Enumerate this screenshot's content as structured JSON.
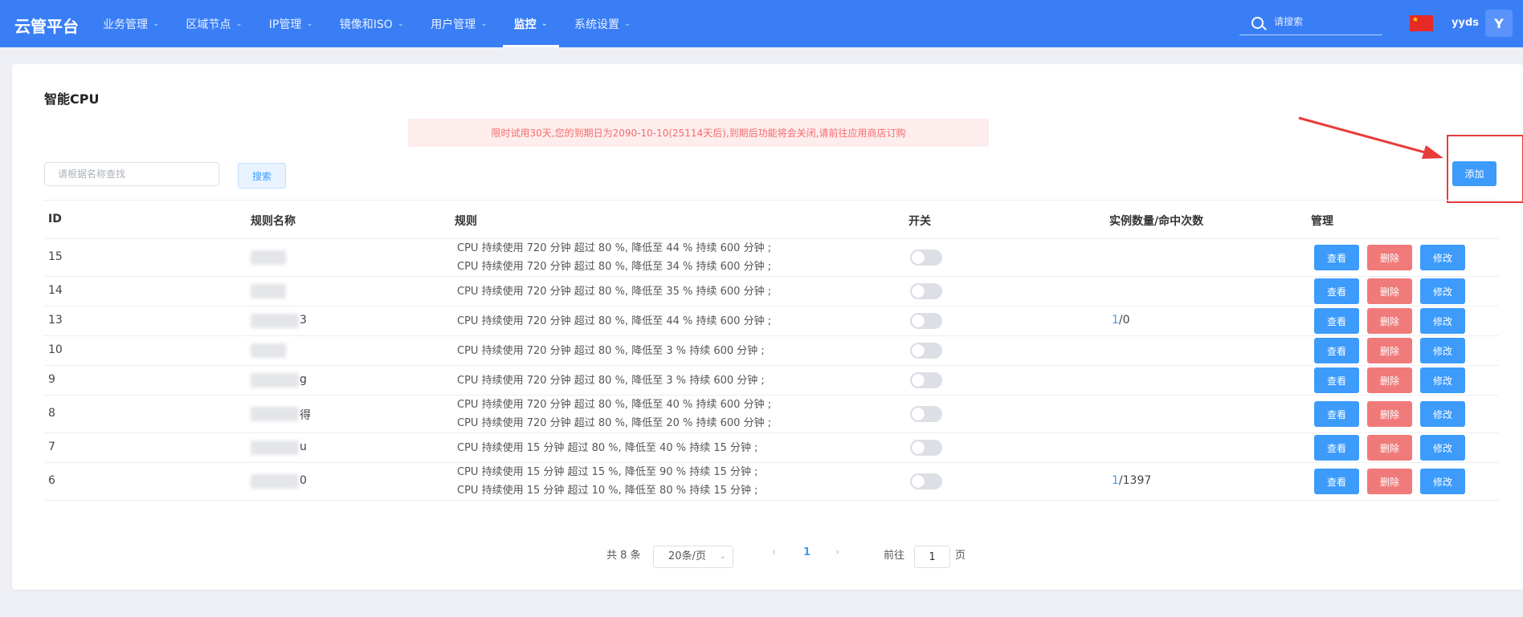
{
  "brand": "云管平台",
  "nav": [
    {
      "label": "业务管理",
      "name": "nav-business"
    },
    {
      "label": "区域节点",
      "name": "nav-region"
    },
    {
      "label": "IP管理",
      "name": "nav-ip"
    },
    {
      "label": "镜像和ISO",
      "name": "nav-image"
    },
    {
      "label": "用户管理",
      "name": "nav-user"
    },
    {
      "label": "监控",
      "name": "nav-monitor",
      "active": true
    },
    {
      "label": "系统设置",
      "name": "nav-settings"
    }
  ],
  "header": {
    "search_placeholder": "请搜索",
    "username": "yyds",
    "avatar_letter": "Y",
    "flag_icon": "china-flag-icon"
  },
  "page": {
    "title": "智能CPU",
    "alert": "限时试用30天,您的到期日为2090-10-10(25114天后),到期后功能将会关闭,请前往应用商店订购",
    "filter_placeholder": "请根据名称查找",
    "search_label": "搜索",
    "add_label": "添加"
  },
  "table": {
    "headers": [
      "ID",
      "规则名称",
      "规则",
      "开关",
      "实例数量/命中次数",
      "管理"
    ],
    "actions": {
      "view": "查看",
      "delete": "删除",
      "edit": "修改"
    },
    "rows": [
      {
        "id": "15",
        "name": "",
        "rules": [
          "CPU 持续使用 720 分钟 超过 80 %, 降低至 44 % 持续 600 分钟 ;",
          "CPU 持续使用 720 分钟 超过 80 %, 降低至 34 % 持续 600 分钟 ;"
        ],
        "switch": false,
        "count": "",
        "hits": ""
      },
      {
        "id": "14",
        "name": "",
        "rules": [
          "CPU 持续使用 720 分钟 超过 80 %, 降低至 35 % 持续 600 分钟 ;"
        ],
        "switch": false,
        "count": "",
        "hits": ""
      },
      {
        "id": "13",
        "name": "3",
        "rules": [
          "CPU 持续使用 720 分钟 超过 80 %, 降低至 44 % 持续 600 分钟 ;"
        ],
        "switch": false,
        "count": "1",
        "hits": "/0"
      },
      {
        "id": "10",
        "name": "",
        "rules": [
          "CPU 持续使用 720 分钟 超过 80 %, 降低至 3 % 持续 600 分钟 ;"
        ],
        "switch": false,
        "count": "",
        "hits": ""
      },
      {
        "id": "9",
        "name": "g",
        "rules": [
          "CPU 持续使用 720 分钟 超过 80 %, 降低至 3 % 持续 600 分钟 ;"
        ],
        "switch": false,
        "count": "",
        "hits": ""
      },
      {
        "id": "8",
        "name": "得",
        "rules": [
          "CPU 持续使用 720 分钟 超过 80 %, 降低至 40 % 持续 600 分钟 ;",
          "CPU 持续使用 720 分钟 超过 80 %, 降低至 20 % 持续 600 分钟 ;"
        ],
        "switch": false,
        "count": "",
        "hits": ""
      },
      {
        "id": "7",
        "name": "u",
        "rules": [
          "CPU 持续使用 15 分钟 超过 80 %, 降低至 40 % 持续 15 分钟 ;"
        ],
        "switch": false,
        "count": "",
        "hits": ""
      },
      {
        "id": "6",
        "name": "0",
        "rules": [
          "CPU 持续使用 15 分钟 超过 15 %, 降低至 90 % 持续 15 分钟 ;",
          "CPU 持续使用 15 分钟 超过 10 %, 降低至 80 % 持续 15 分钟 ;"
        ],
        "switch": false,
        "count": "1",
        "hits": "/1397"
      }
    ]
  },
  "pagination": {
    "total": "共 8 条",
    "page_size": "20条/页",
    "current": "1",
    "goto_prefix": "前往",
    "goto_value": "1",
    "goto_suffix": "页"
  },
  "colors": {
    "nav": "#3a7ef6",
    "primary": "#3c9bfb",
    "danger": "#f07a7a",
    "alert_text": "#f56c6c",
    "annotation": "#e83c3a"
  }
}
